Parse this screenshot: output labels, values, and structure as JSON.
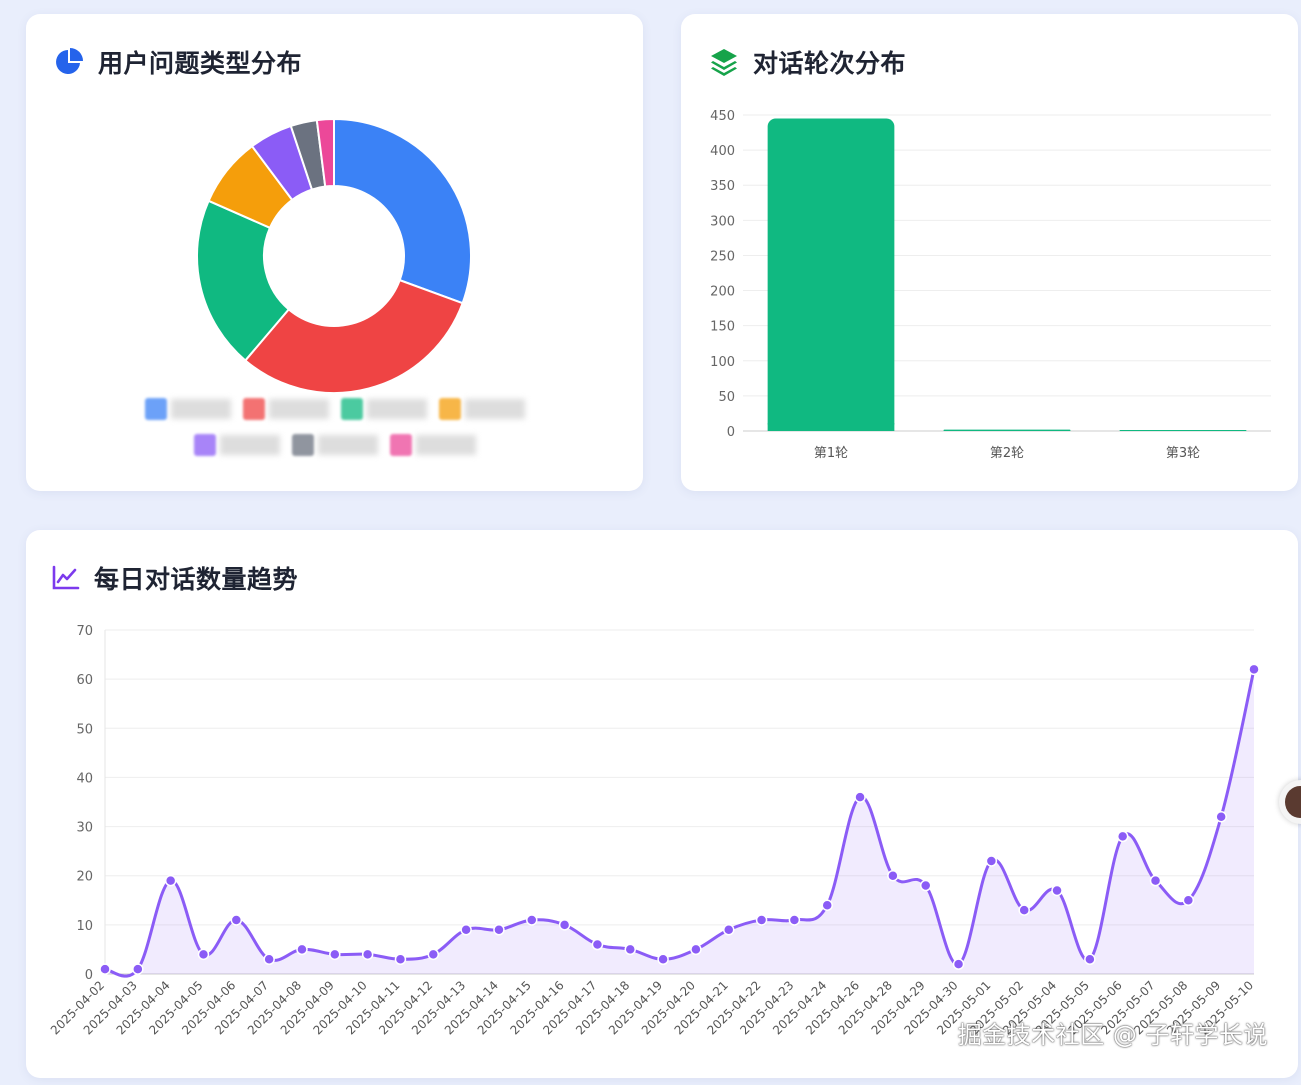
{
  "pie_card": {
    "title": "用户问题类型分布",
    "icon": "pie-chart-icon"
  },
  "rounds_card": {
    "title": "对话轮次分布",
    "icon": "layers-icon"
  },
  "trend_card": {
    "title": "每日对话数量趋势",
    "icon": "line-chart-icon"
  },
  "watermark": "掘金技术社区 @ 子轩学长说",
  "colors": {
    "blue": "#3b82f6",
    "red": "#ef4444",
    "green": "#10b981",
    "orange": "#f59e0b",
    "purple": "#8b5cf6",
    "gray": "#6b7280",
    "pink": "#ec4899",
    "line": "#8b5cf6"
  },
  "chart_data": [
    {
      "type": "pie",
      "variant": "donut",
      "slices": [
        {
          "value": 30.6,
          "color": "#3b82f6"
        },
        {
          "value": 30.6,
          "color": "#ef4444"
        },
        {
          "value": 20.4,
          "color": "#10b981"
        },
        {
          "value": 8.2,
          "color": "#f59e0b"
        },
        {
          "value": 5.1,
          "color": "#8b5cf6"
        },
        {
          "value": 3.1,
          "color": "#6b7280"
        },
        {
          "value": 2.0,
          "color": "#ec4899"
        }
      ],
      "legend_placement": "bottom",
      "legend_labels_obscured": true
    },
    {
      "type": "bar",
      "categories": [
        "第1轮",
        "第2轮",
        "第3轮"
      ],
      "values": [
        445,
        2,
        1
      ],
      "ylim": [
        0,
        450
      ],
      "yticks": [
        0,
        50,
        100,
        150,
        200,
        250,
        300,
        350,
        400,
        450
      ],
      "color": "#10b981",
      "grid": true
    },
    {
      "type": "line",
      "smooth": true,
      "area": true,
      "x": [
        "2025-04-02",
        "2025-04-03",
        "2025-04-04",
        "2025-04-05",
        "2025-04-06",
        "2025-04-07",
        "2025-04-08",
        "2025-04-09",
        "2025-04-10",
        "2025-04-11",
        "2025-04-12",
        "2025-04-13",
        "2025-04-14",
        "2025-04-15",
        "2025-04-16",
        "2025-04-17",
        "2025-04-18",
        "2025-04-19",
        "2025-04-20",
        "2025-04-21",
        "2025-04-22",
        "2025-04-23",
        "2025-04-24",
        "2025-04-26",
        "2025-04-28",
        "2025-04-29",
        "2025-04-30",
        "2025-05-01",
        "2025-05-02",
        "2025-05-04",
        "2025-05-05",
        "2025-05-06",
        "2025-05-07",
        "2025-05-08",
        "2025-05-09",
        "2025-05-10"
      ],
      "y": [
        1,
        1,
        19,
        4,
        11,
        3,
        5,
        4,
        4,
        3,
        4,
        9,
        9,
        11,
        10,
        6,
        5,
        3,
        5,
        9,
        11,
        11,
        14,
        36,
        20,
        18,
        2,
        23,
        13,
        17,
        3,
        28,
        19,
        15,
        32,
        62
      ],
      "ylim": [
        0,
        70
      ],
      "yticks": [
        0,
        10,
        20,
        30,
        40,
        50,
        60,
        70
      ],
      "color": "#8b5cf6",
      "grid": true
    }
  ]
}
